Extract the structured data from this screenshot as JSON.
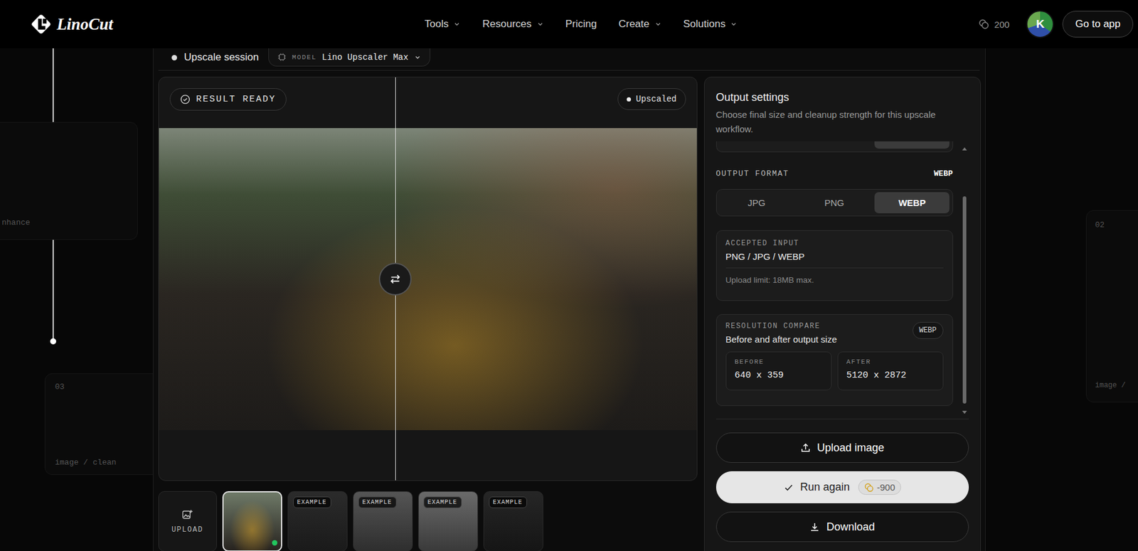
{
  "brand": {
    "name": "LinoCut"
  },
  "nav": [
    {
      "label": "Tools",
      "dropdown": true
    },
    {
      "label": "Resources",
      "dropdown": true
    },
    {
      "label": "Pricing",
      "dropdown": false
    },
    {
      "label": "Create",
      "dropdown": true
    },
    {
      "label": "Solutions",
      "dropdown": true
    }
  ],
  "account": {
    "credits": "200",
    "avatar_initial": "K",
    "cta": "Go to app"
  },
  "canvas": {
    "cards": [
      {
        "label": "nhance"
      },
      {
        "index": "03",
        "label": "image / clean"
      },
      {
        "index": "02",
        "label": "image /"
      }
    ]
  },
  "session": {
    "title": "Upscale session",
    "model_label": "MODEL",
    "model": "Lino Upscaler Max"
  },
  "preview": {
    "status": "RESULT READY",
    "badge": "Upscaled",
    "split": 0.44
  },
  "gallery": {
    "upload_label": "UPLOAD",
    "items": [
      {
        "selected": true
      },
      {
        "badge": "EXAMPLE",
        "selected": false
      },
      {
        "badge": "EXAMPLE",
        "selected": false
      },
      {
        "badge": "EXAMPLE",
        "selected": false
      },
      {
        "badge": "EXAMPLE",
        "selected": false
      }
    ]
  },
  "settings": {
    "title": "Output settings",
    "subtitle": "Choose final size and cleanup strength for this upscale workflow.",
    "hidden_segments": [
      {
        "selected": false
      },
      {
        "selected": false
      },
      {
        "selected": true
      }
    ],
    "format_label": "OUTPUT FORMAT",
    "format_value": "WEBP",
    "formats": [
      {
        "label": "JPG",
        "selected": false
      },
      {
        "label": "PNG",
        "selected": false
      },
      {
        "label": "WEBP",
        "selected": true
      }
    ],
    "accepted": {
      "label": "ACCEPTED INPUT",
      "value": "PNG / JPG / WEBP",
      "note": "Upload limit: 18MB max."
    },
    "compare": {
      "label": "RESOLUTION COMPARE",
      "title": "Before and after output size",
      "badge": "WEBP",
      "before_label": "BEFORE",
      "before": "640 x 359",
      "after_label": "AFTER",
      "after": "5120 x 2872"
    },
    "scroll_thumb": {
      "offset": 0.17,
      "level": 0.81
    },
    "actions": {
      "upload": "Upload image",
      "run": "Run again",
      "run_cost": "-900",
      "download": "Download"
    }
  }
}
